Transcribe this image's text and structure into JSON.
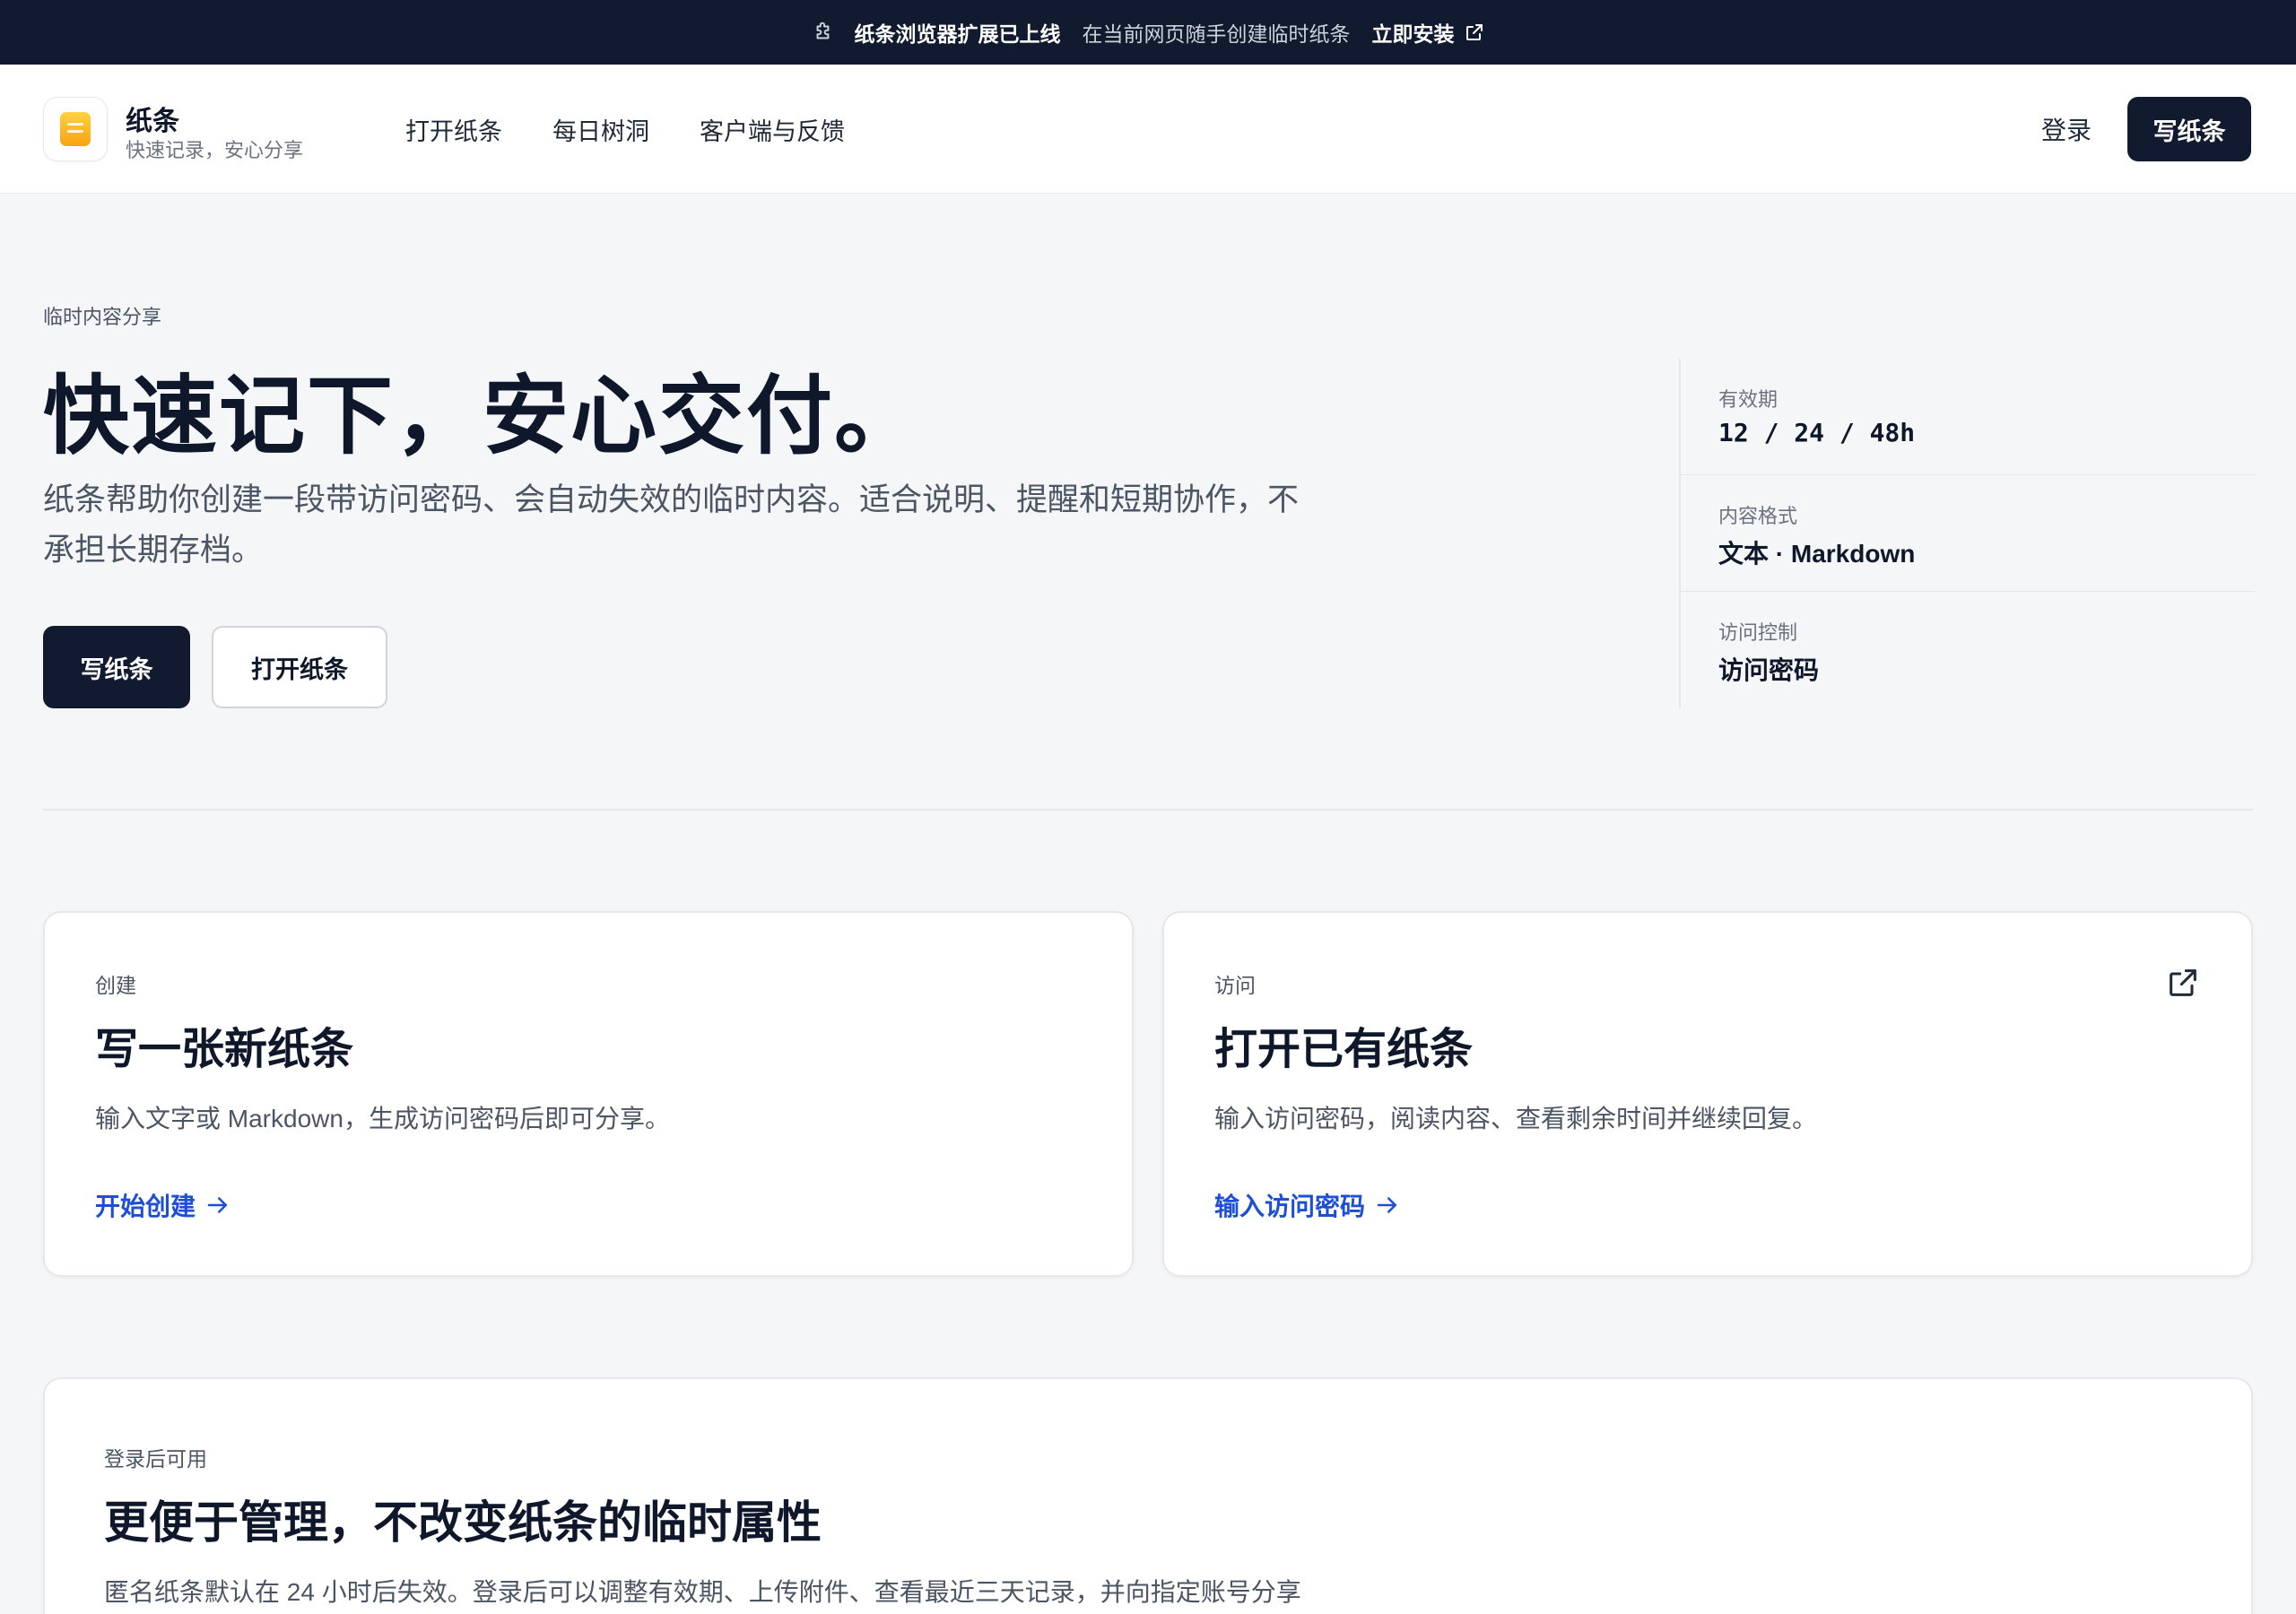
{
  "announcement": {
    "title": "纸条浏览器扩展已上线",
    "text": "在当前网页随手创建临时纸条",
    "install": "立即安装"
  },
  "header": {
    "brand_name": "纸条",
    "brand_tagline": "快速记录，安心分享",
    "nav": [
      "打开纸条",
      "每日树洞",
      "客户端与反馈"
    ],
    "login": "登录",
    "write": "写纸条"
  },
  "hero": {
    "eyebrow": "临时内容分享",
    "title": "快速记下，安心交付。",
    "description": "纸条帮助你创建一段带访问密码、会自动失效的临时内容。适合说明、提醒和短期协作，不承担长期存档。",
    "primary_button": "写纸条",
    "secondary_button": "打开纸条"
  },
  "specs": [
    {
      "label": "有效期",
      "value": "12 / 24 / 48h"
    },
    {
      "label": "内容格式",
      "value": "文本 · Markdown"
    },
    {
      "label": "访问控制",
      "value": "访问密码"
    }
  ],
  "cards": [
    {
      "eyebrow": "创建",
      "title": "写一张新纸条",
      "description": "输入文字或 Markdown，生成访问密码后即可分享。",
      "link": "开始创建"
    },
    {
      "eyebrow": "访问",
      "title": "打开已有纸条",
      "description": "输入访问密码，阅读内容、查看剩余时间并继续回复。",
      "link": "输入访问密码"
    }
  ],
  "login_card": {
    "eyebrow": "登录后可用",
    "title": "更便于管理，不改变纸条的临时属性",
    "description": "匿名纸条默认在 24 小时后失效。登录后可以调整有效期、上传附件、查看最近三天记录，并向指定账号分享"
  },
  "colors": {
    "dark": "#111a2e",
    "accent_link": "#1d4ed8",
    "background": "#f5f6f8",
    "logo_yellow": "#f9a311"
  },
  "icons": [
    "puzzle-icon",
    "external-link-icon",
    "note-logo-icon",
    "arrow-right-icon"
  ]
}
